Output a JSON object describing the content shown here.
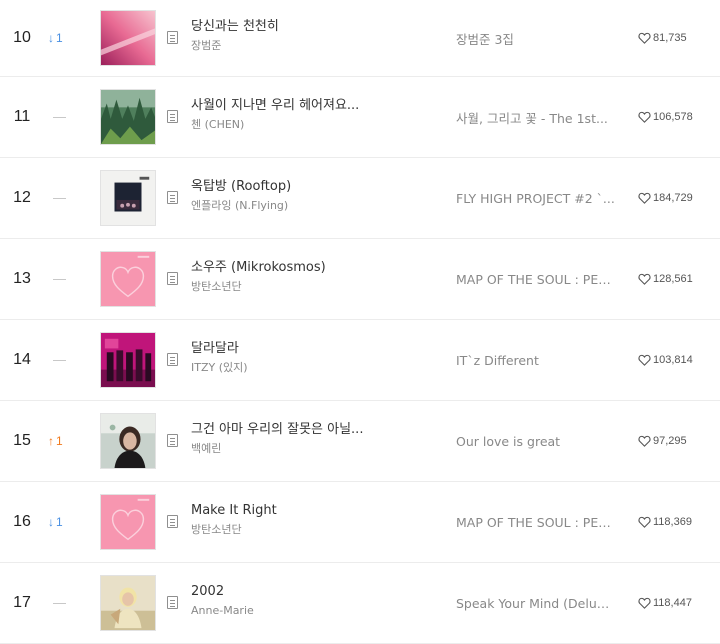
{
  "chart": {
    "rows": [
      {
        "rank": "10",
        "change_dir": "down",
        "change_arrow": "↓",
        "change_value": "1",
        "title": "당신과는 천천히",
        "artist": "장범준",
        "album": "장범준 3집",
        "likes": "81,735",
        "cover": "pink-gradient"
      },
      {
        "rank": "11",
        "change_dir": "same",
        "change_arrow": "",
        "change_value": "",
        "title": "사월이 지나면 우리 헤어져요...",
        "artist": "첸 (CHEN)",
        "album": "사월, 그리고 꽃 - The 1st...",
        "likes": "106,578",
        "cover": "green-forest"
      },
      {
        "rank": "12",
        "change_dir": "same",
        "change_arrow": "",
        "change_value": "",
        "title": "옥탑방 (Rooftop)",
        "artist": "엔플라잉 (N.Flying)",
        "album": "FLY HIGH PROJECT #2 `...",
        "likes": "184,729",
        "cover": "night-photo"
      },
      {
        "rank": "13",
        "change_dir": "same",
        "change_arrow": "",
        "change_value": "",
        "title": "소우주 (Mikrokosmos)",
        "artist": "방탄소년단",
        "album": "MAP OF THE SOUL : PER...",
        "likes": "128,561",
        "cover": "pink-heart"
      },
      {
        "rank": "14",
        "change_dir": "same",
        "change_arrow": "",
        "change_value": "",
        "title": "달라달라",
        "artist": "ITZY (있지)",
        "album": "IT`z Different",
        "likes": "103,814",
        "cover": "magenta-group"
      },
      {
        "rank": "15",
        "change_dir": "up",
        "change_arrow": "↑",
        "change_value": "1",
        "title": "그건 아마 우리의 잘못은 아닐...",
        "artist": "백예린",
        "album": "Our love is great",
        "likes": "97,295",
        "cover": "portrait-dark"
      },
      {
        "rank": "16",
        "change_dir": "down",
        "change_arrow": "↓",
        "change_value": "1",
        "title": "Make It Right",
        "artist": "방탄소년단",
        "album": "MAP OF THE SOUL : PER...",
        "likes": "118,369",
        "cover": "pink-heart"
      },
      {
        "rank": "17",
        "change_dir": "same",
        "change_arrow": "",
        "change_value": "",
        "title": "2002",
        "artist": "Anne-Marie",
        "album": "Speak Your Mind (Deluxe)",
        "likes": "118,447",
        "cover": "portrait-light"
      }
    ]
  },
  "icons": {
    "lyric": "lyric-doc-icon",
    "heart": "heart-outline-icon",
    "down_arrow": "arrow-down-icon",
    "up_arrow": "arrow-up-icon",
    "no_change": "dash-icon"
  },
  "colors": {
    "rank_down": "#4a90e2",
    "rank_up": "#f07a1e",
    "rank_same": "#c8c8c8",
    "divider": "#ececec",
    "title": "#333333",
    "sub": "#888888"
  }
}
